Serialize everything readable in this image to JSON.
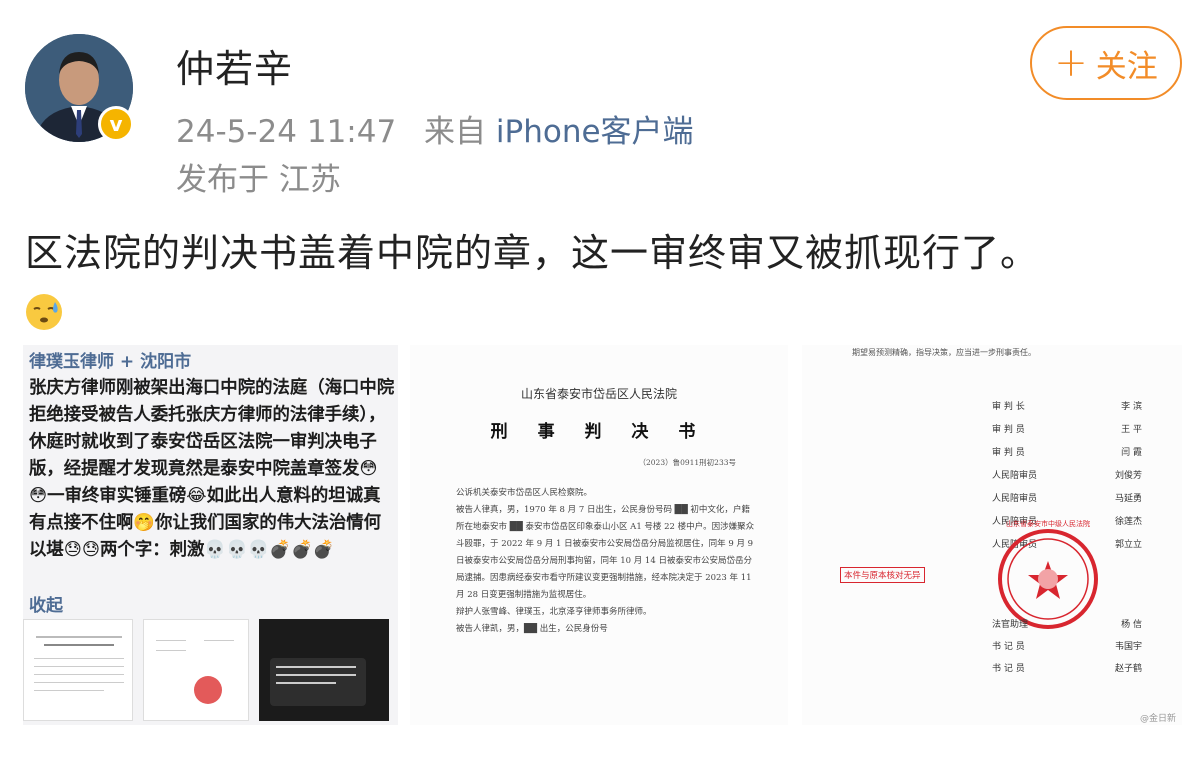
{
  "post": {
    "author": "仲若辛",
    "timestamp": "24-5-24 11:47",
    "source_prefix": "来自",
    "source": "iPhone客户端",
    "location": "发布于 江苏",
    "follow_label": "关注",
    "text": "区法院的判决书盖着中院的章，这一审终审又被抓现行了。"
  },
  "images": {
    "img1": {
      "header": "律璞玉律师 + 沈阳市",
      "body": "张庆方律师刚被架出海口中院的法庭（海口中院拒绝接受被告人委托张庆方律师的法律手续），休庭时就收到了泰安岱岳区法院一审判决电子版，经提醒才发现竟然是泰安中院盖章签发😳😳一审终审实锤重磅😂如此出人意料的坦诚真有点接不住啊🤭你让我们国家的伟大法治情何以堪😓😓两个字：刺激💀💀💀💣💣💣",
      "fold": "收起"
    },
    "img2": {
      "court": "山东省泰安市岱岳区人民法院",
      "title": "刑 事 判 决 书",
      "case_no": "（2023）鲁0911刑初233号",
      "para1": "公诉机关泰安市岱岳区人民检察院。",
      "para2": "被告人律真，男，1970 年 8 月 7 日出生，公民身份号码 ██ 初中文化，户籍所在地泰安市 ██ 泰安市岱岳区印象泰山小区 A1 号楼 22 楼中户。因涉嫌聚众斗殴罪，于 2022 年 9 月 1 日被泰安市公安局岱岳分局监视居住，同年 9 月 9 日被泰安市公安局岱岳分局刑事拘留，同年 10 月 14 日被泰安市公安局岱岳分局逮捕。因患病经泰安市看守所建议变更强制措施，经本院决定于 2023 年 11 月 28 日变更强制措施为监视居住。",
      "para3": "辩护人张雪峰、律璞玉，北京泽亨律师事务所律师。",
      "para4": "被告人律凯，男，██ 出生，公民身份号"
    },
    "img3": {
      "top_line": "期望易预测精确，指导决策，应当进一步刑事责任。",
      "judges": [
        {
          "role": "审 判 长",
          "name": "李 滨"
        },
        {
          "role": "审 判 员",
          "name": "王 平"
        },
        {
          "role": "审 判 员",
          "name": "闫 霞"
        },
        {
          "role": "人民陪审员",
          "name": "刘俊芳"
        },
        {
          "role": "人民陪审员",
          "name": "马延勇"
        },
        {
          "role": "人民陪审员",
          "name": "徐莲杰"
        },
        {
          "role": "人民陪审员",
          "name": "郭立立"
        }
      ],
      "stamp_text": "本件与原本核对无异",
      "seal_text": "山东省泰安市中级人民法院",
      "clerks": [
        {
          "role": "法官助理",
          "name": "杨 信"
        },
        {
          "role": "书 记 员",
          "name": "韦国宇"
        },
        {
          "role": "书 记 员",
          "name": "赵子鹤"
        }
      ],
      "watermark": "@金日新"
    }
  },
  "colors": {
    "accent": "#f28c28",
    "link": "#4e6c94",
    "meta": "#8c8c8c",
    "seal": "#d8262f"
  }
}
